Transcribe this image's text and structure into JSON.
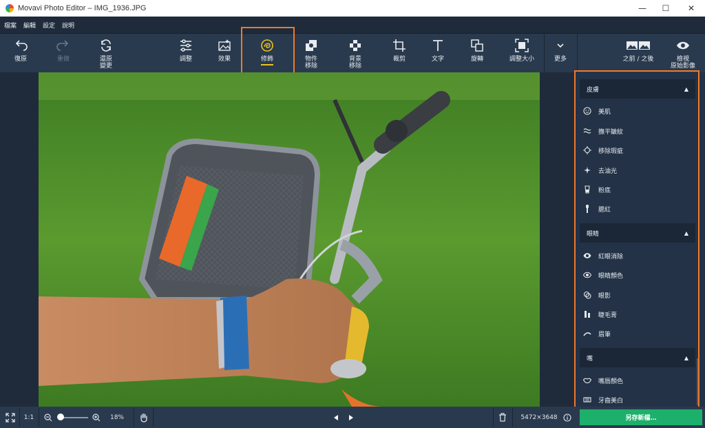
{
  "window": {
    "title": "Movavi Photo Editor – IMG_1936.JPG",
    "minimize": "—",
    "maximize": "☐",
    "close": "✕"
  },
  "menu": [
    "檔案",
    "編輯",
    "設定",
    "說明"
  ],
  "toolbar": {
    "undo": "復原",
    "redo": "重做",
    "revert": [
      "還原",
      "變更"
    ],
    "adjust": "調整",
    "effects": "效果",
    "retouch": "修飾",
    "object_removal": [
      "物件",
      "移除"
    ],
    "background_removal": [
      "背景",
      "移除"
    ],
    "crop": "裁剪",
    "text": "文字",
    "rotate": "旋轉",
    "resize": "調整大小",
    "more": "更多",
    "before_after": "之前 / 之後",
    "view_original": [
      "檢視",
      "原始影像"
    ]
  },
  "panel": {
    "sections": [
      {
        "title": "皮膚",
        "items": [
          {
            "label": "美肌",
            "icon": "smile-icon"
          },
          {
            "label": "撫平皺紋",
            "icon": "wrinkle-icon"
          },
          {
            "label": "移除瑕疵",
            "icon": "target-icon"
          },
          {
            "label": "去油光",
            "icon": "sparkle-icon"
          },
          {
            "label": "粉底",
            "icon": "foundation-icon"
          },
          {
            "label": "腮紅",
            "icon": "brush-icon"
          }
        ]
      },
      {
        "title": "眼睛",
        "items": [
          {
            "label": "紅眼消除",
            "icon": "eye-icon"
          },
          {
            "label": "眼睛顏色",
            "icon": "eye-icon"
          },
          {
            "label": "眼影",
            "icon": "eyeshadow-icon"
          },
          {
            "label": "睫毛膏",
            "icon": "mascara-icon"
          },
          {
            "label": "眉筆",
            "icon": "eyebrow-icon"
          }
        ]
      },
      {
        "title": "嘴",
        "items": [
          {
            "label": "嘴唇顏色",
            "icon": "lips-icon"
          },
          {
            "label": "牙齒美白",
            "icon": "teeth-icon"
          }
        ]
      }
    ]
  },
  "status": {
    "ratio": "1:1",
    "zoom": "18%",
    "image_size": "5472×3648",
    "save_button": "另存新檔…"
  },
  "colors": {
    "accent_highlight": "#f07a28",
    "active_underline": "#f0c419",
    "save_green": "#1db06a",
    "background": "#1f2b3b"
  }
}
